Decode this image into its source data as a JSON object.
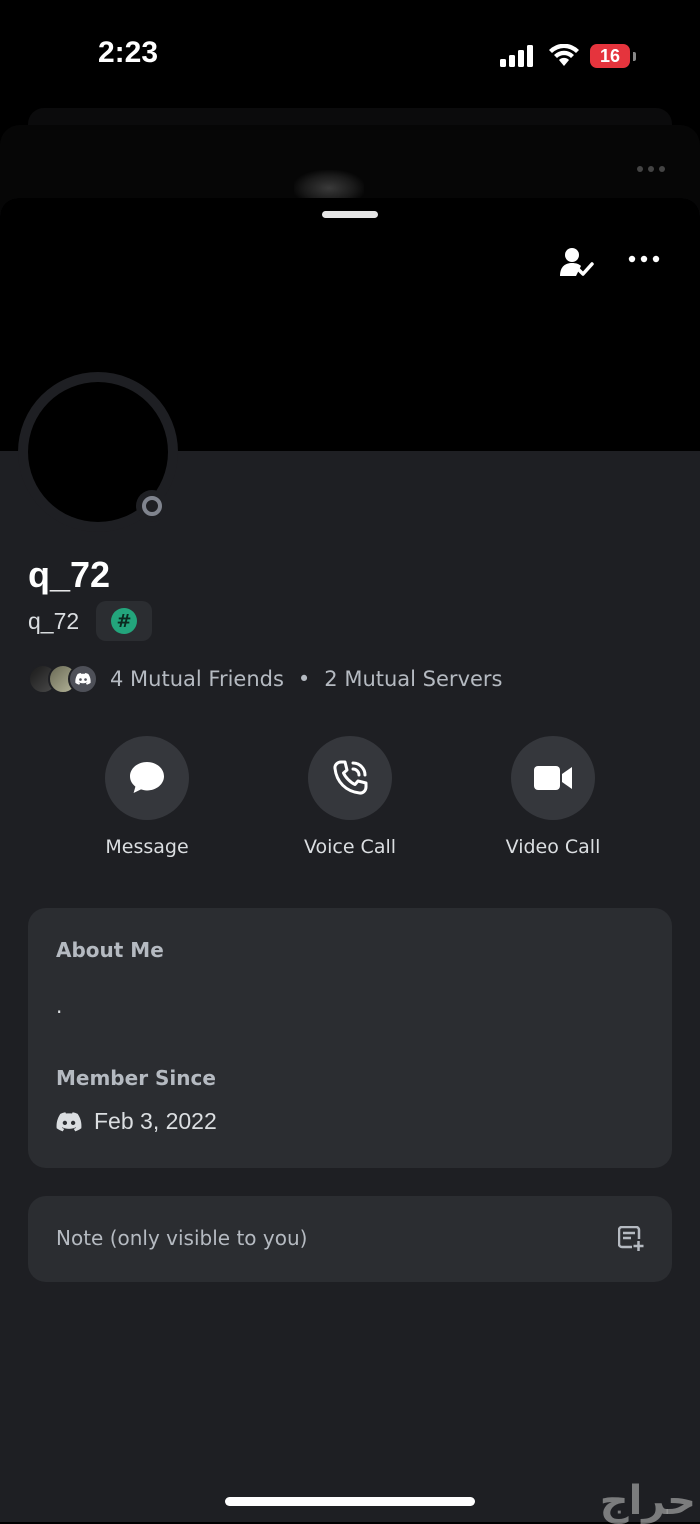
{
  "status_bar": {
    "time": "2:23",
    "battery_level": "16"
  },
  "profile": {
    "display_name": "q_72",
    "username": "q_72",
    "badge_symbol": "#",
    "mutual_friends": "4 Mutual Friends",
    "separator": "•",
    "mutual_servers": "2 Mutual Servers"
  },
  "actions": {
    "message_label": "Message",
    "voice_call_label": "Voice Call",
    "video_call_label": "Video Call"
  },
  "about": {
    "heading": "About Me",
    "text": ".",
    "member_since_heading": "Member Since",
    "member_since_date": "Feb 3, 2022"
  },
  "note": {
    "placeholder": "Note (only visible to you)"
  },
  "watermark": {
    "text": "حراج"
  },
  "colors": {
    "background": "#1e1f23",
    "card": "#2b2d31",
    "button": "#35373c",
    "badge_green": "#23a57c",
    "battery_red": "#e5343d",
    "status_gray": "#80848e"
  },
  "icons": {
    "signal": "cellular-signal-icon",
    "wifi": "wifi-icon",
    "friend_status": "person-check-icon",
    "more": "ellipsis-icon",
    "message": "chat-bubble-icon",
    "voice_call": "phone-icon",
    "video_call": "video-camera-icon",
    "discord": "discord-logo-icon",
    "note": "add-note-icon"
  }
}
